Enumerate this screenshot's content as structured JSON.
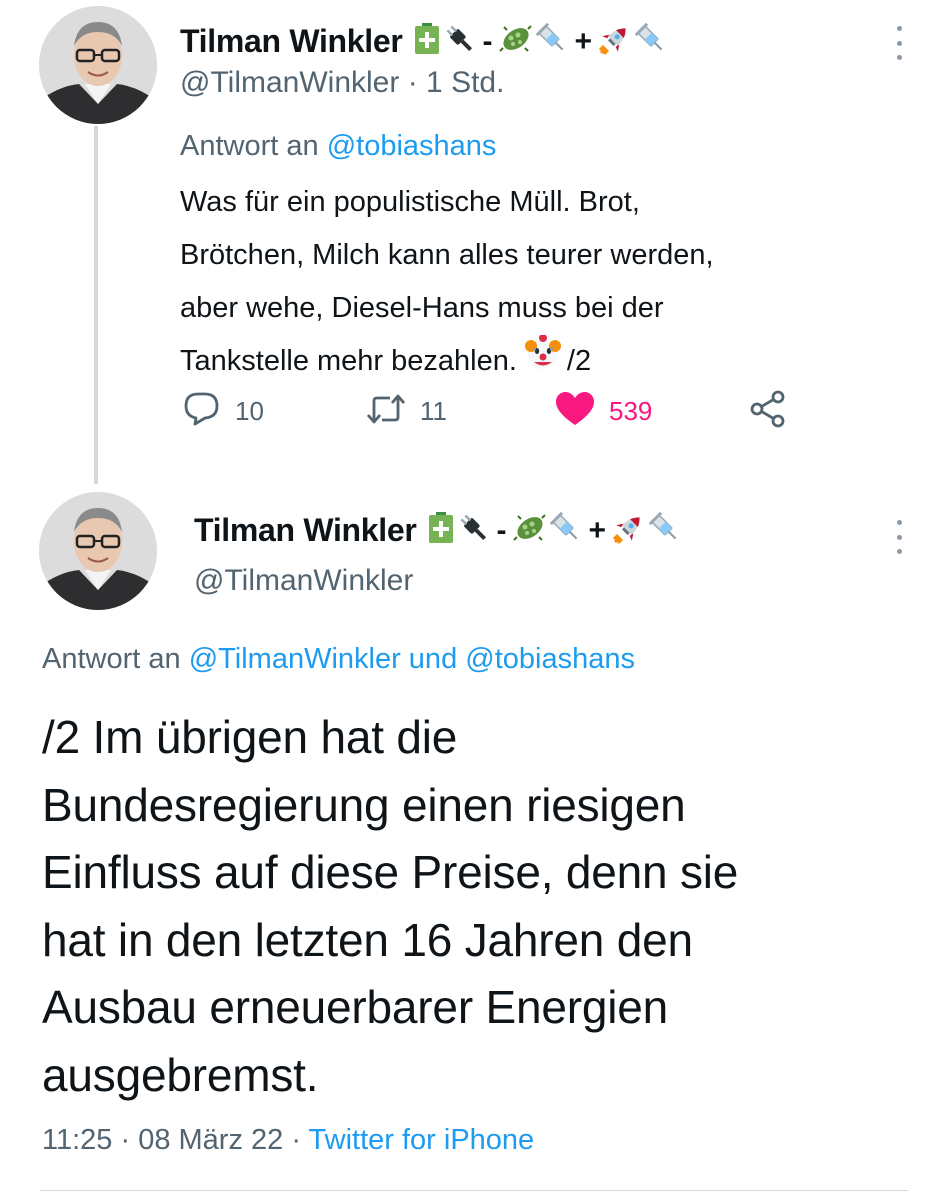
{
  "tweet_parent": {
    "author_name": "Tilman Winkler",
    "name_badges": {
      "first_separator": "-",
      "second_separator": "+",
      "icons": [
        "battery-icon",
        "plug-icon",
        "virus-icon",
        "syringe-icon",
        "rocket-icon",
        "syringe-icon"
      ]
    },
    "handle": "@TilmanWinkler",
    "time": "· 1 Std.",
    "reply_prefix": "Antwort an",
    "reply_target": "@tobiashans",
    "body_lines": [
      "Was für ein populistische Müll. Brot,",
      "Brötchen, Milch kann alles teurer werden,",
      "aber wehe, Diesel-Hans muss bei der",
      "Tankstelle mehr bezahlen."
    ],
    "body_suffix": "/2",
    "replies": "10",
    "retweets": "11",
    "likes": "539"
  },
  "tweet_main": {
    "author_name": "Tilman Winkler",
    "name_badges": {
      "first_separator": "-",
      "second_separator": "+"
    },
    "handle": "@TilmanWinkler",
    "reply_prefix": "Antwort an",
    "reply_target": "@TilmanWinkler und @tobiashans",
    "body_lines": [
      "/2 Im übrigen hat die",
      "Bundesregierung einen riesigen",
      "Einfluss auf diese Preise, denn sie",
      "hat in den letzten 16 Jahren den",
      "Ausbau erneuerbarer Energien",
      "ausgebremst."
    ],
    "timestamp": "11:25 · 08 März 22 ·",
    "source": "Twitter for iPhone"
  },
  "colors": {
    "link": "#1d9bf0",
    "like": "#f91880",
    "secondary_text": "#536471"
  }
}
